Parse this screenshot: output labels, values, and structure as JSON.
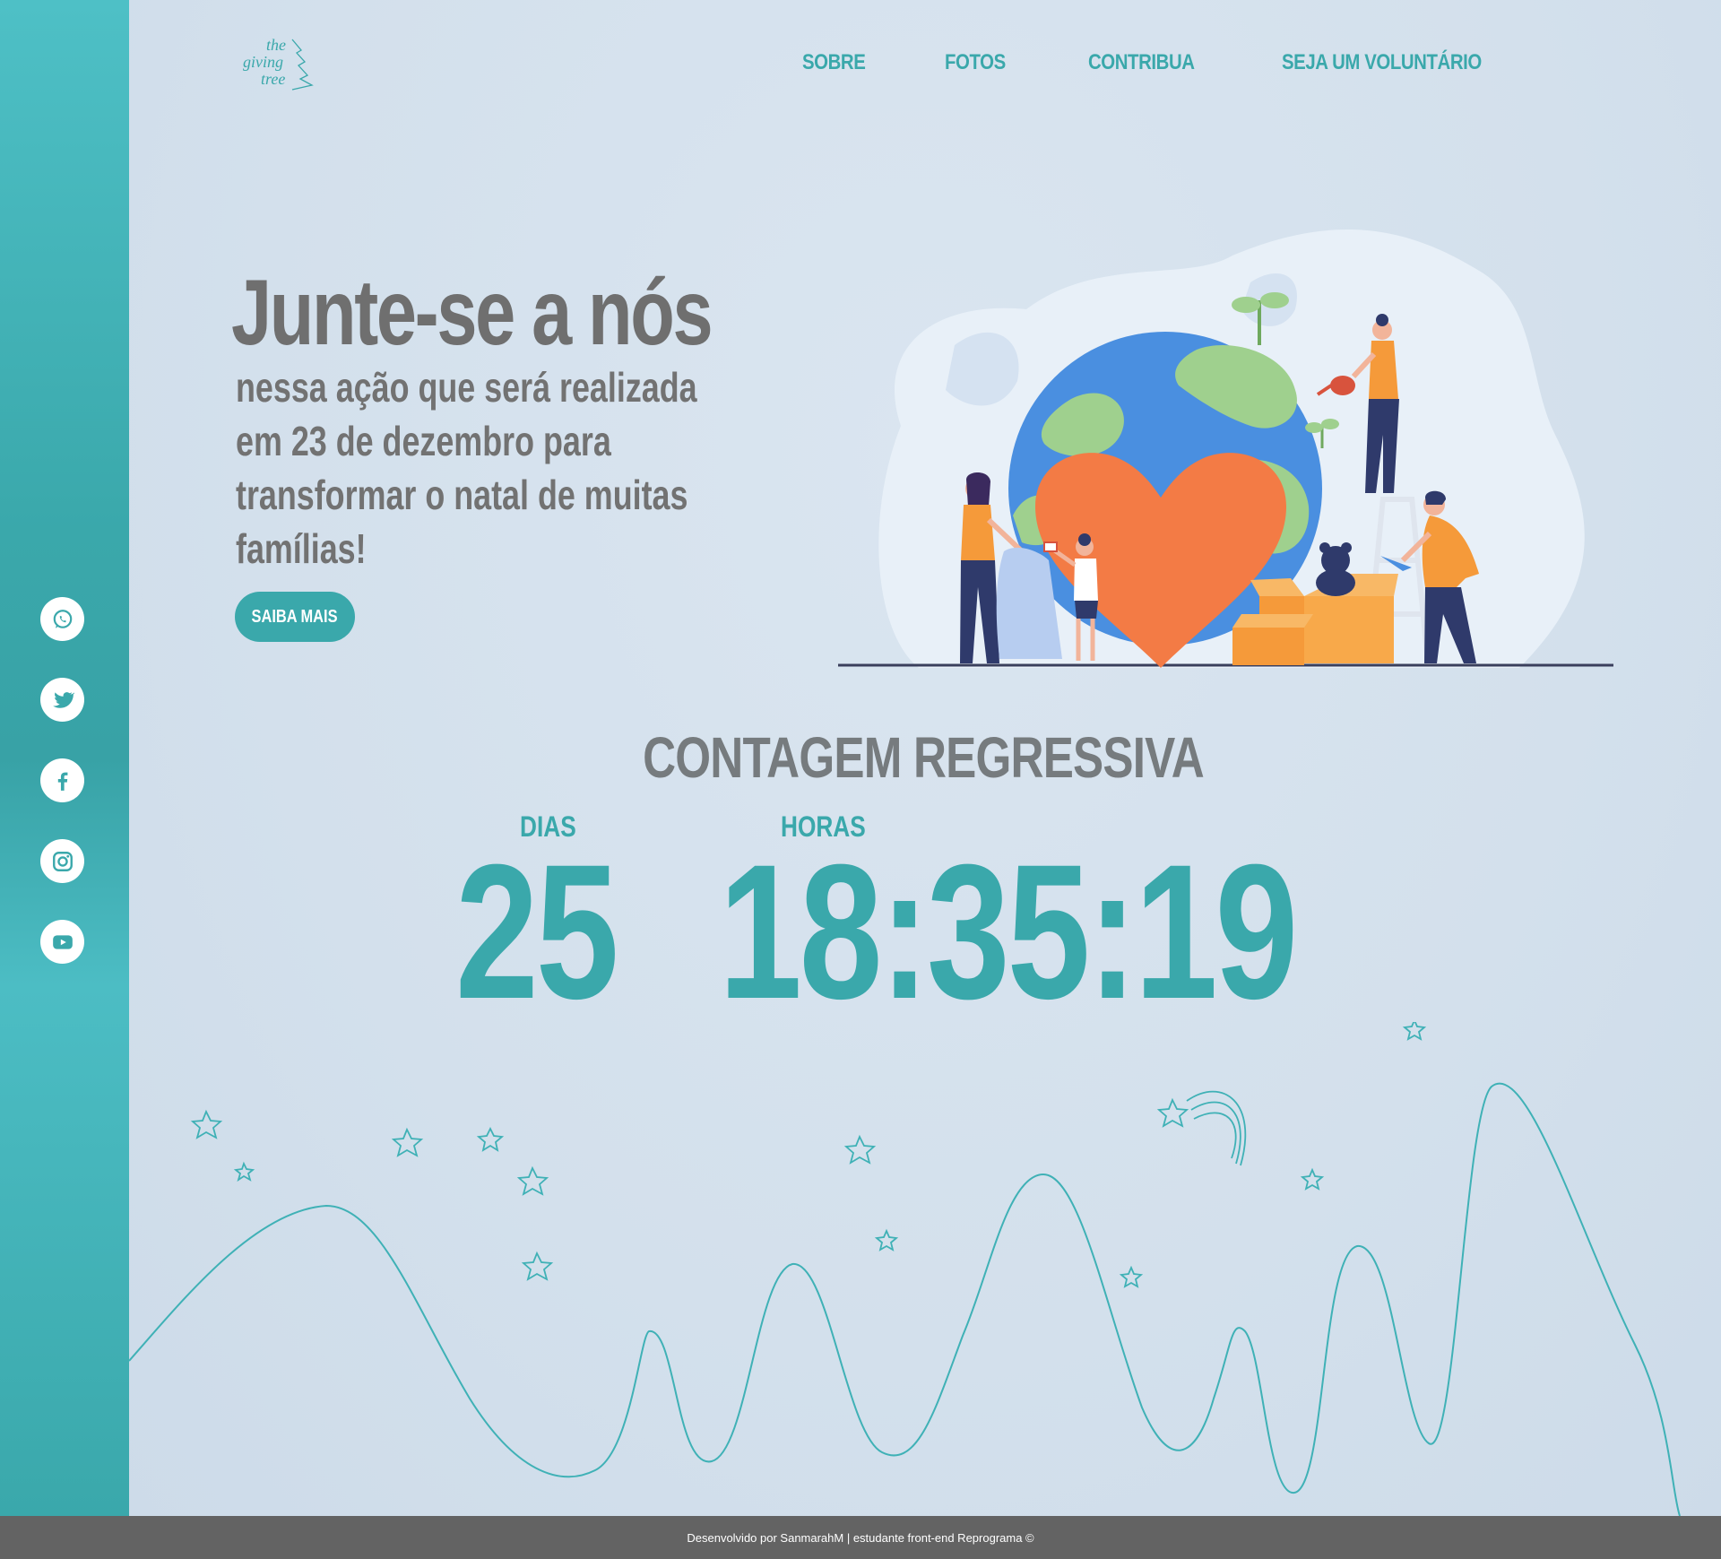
{
  "brand": {
    "logo_line1": "the",
    "logo_line2": "giving",
    "logo_line3": "tree"
  },
  "nav": {
    "items": [
      "SOBRE",
      "FOTOS",
      "CONTRIBUA",
      "SEJA UM VOLUNTÁRIO"
    ]
  },
  "sidebar": {
    "social_icons": [
      "whatsapp-icon",
      "twitter-icon",
      "facebook-icon",
      "instagram-icon",
      "youtube-icon"
    ]
  },
  "hero": {
    "title": "Junte-se a nós",
    "subtitle": "nessa ação que será realizada em 23 de dezembro para transformar o natal de muitas famílias!",
    "button_label": "SAIBA MAIS"
  },
  "countdown": {
    "title": "CONTAGEM REGRESSIVA",
    "days_label": "DIAS",
    "hours_label": "HORAS",
    "days_value": "25",
    "time_value": "18:35:19"
  },
  "footer": {
    "text": "Desenvolvido por SanmarahM | estudante front-end Reprograma ©"
  },
  "colors": {
    "accent": "#3aa8ab",
    "background": "#d6e2ee",
    "heading_gray": "#6f6f6f",
    "footer_bg": "#636363",
    "heart": "#f37b45",
    "globe_blue": "#4a8fe0",
    "globe_green": "#9fd08e"
  }
}
